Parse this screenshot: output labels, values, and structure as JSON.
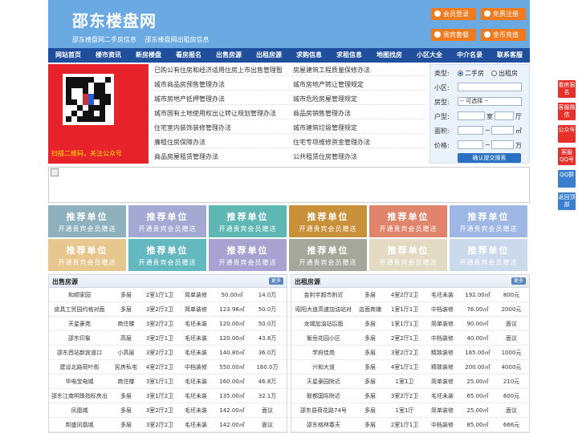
{
  "header": {
    "site_title": "邵东楼盘网",
    "sublinks": [
      "邵东楼盘网二手房信息",
      "邵东楼盘网出租房信息"
    ],
    "buttons": [
      "会员登录",
      "免费注册",
      "贵宾套餐",
      "金币充值"
    ]
  },
  "nav": [
    "网站首页",
    "楼市资讯",
    "新房楼盘",
    "看房报名",
    "出售房源",
    "出租房源",
    "求购信息",
    "求租信息",
    "地图找房",
    "小区大全",
    "中介名录",
    "联系客服"
  ],
  "qr": {
    "caption": "扫描二维码，关注公众号"
  },
  "links": [
    "已购公有住房和经济适用住房上市出售管理暂",
    "房屋建筑工程质量保修办法",
    "城市商品房预售管理办法",
    "城市房地产转让管理规定",
    "城市房地产抵押管理办法",
    "城市危险房屋管理规定",
    "城市国有土地使用权出让转让规划管理办法",
    "商品房销售管理办法",
    "住宅室内装饰装修管理办法",
    "城市建筑垃圾管理规定",
    "廉租住房保障办法",
    "住宅专项维修资金管理办法",
    "商品房屋租赁管理办法",
    "公共租赁住房管理办法"
  ],
  "search": {
    "type_label": "类型:",
    "type_options": [
      "二手房",
      "出租房"
    ],
    "area_label": "小区:",
    "room_label": "房型:",
    "room_value": "-- 可选择 --",
    "unit_label": "户型:",
    "unit_room": "室",
    "unit_hall": "厅",
    "size_label": "面积:",
    "size_unit": "㎡",
    "price_label": "价格:",
    "price_unit": "万",
    "submit": "确认提交搜索"
  },
  "ads": {
    "title": "推荐单位",
    "subtitle": "开通贵宾会员赠送",
    "colors": [
      "#8fb1bd",
      "#a3a9d2",
      "#5fb7b3",
      "#c9903a",
      "#e0846c",
      "#9fb7e4",
      "#e7c78e",
      "#64b8c0",
      "#a7a2cf",
      "#a5a79b",
      "#e3dac4",
      "#cbd9ec"
    ]
  },
  "sale": {
    "title": "出售房源",
    "more": "更多",
    "rows": [
      [
        "和顺家园",
        "多层",
        "2室1厅1卫",
        "简单装修",
        "50.00㎡",
        "14.0万"
      ],
      [
        "皮具工贸园约格对面",
        "多层",
        "3室2厅2卫",
        "简单装修",
        "123.98㎡",
        "50.0万"
      ],
      [
        "天星豪苑",
        "商住楼",
        "3室2厅2卫",
        "毛坯未装",
        "120.00㎡",
        "50.0万"
      ],
      [
        "邵东印象",
        "高层",
        "3室2厅1卫",
        "毛坯未装",
        "120.00㎡",
        "43.8万"
      ],
      [
        "邵东西站新宾道口",
        "小高层",
        "3室2厅2卫",
        "毛坯未装",
        "140.80㎡",
        "36.0万"
      ],
      [
        "建设北路荷叶街",
        "民房私宅",
        "4室2厅2卫",
        "中档装修",
        "550.00㎡",
        "160.0万"
      ],
      [
        "华电宝电城",
        "商住楼",
        "3室1厅1卫",
        "毛坯未装",
        "160.00㎡",
        "46.8万"
      ],
      [
        "邵东江南明珠指标房出",
        "多层",
        "3室1厅2卫",
        "毛坯未装",
        "135.00㎡",
        "32.1万"
      ],
      [
        "凤凰城",
        "多层",
        "3室2厅2卫",
        "毛坯未装",
        "142.00㎡",
        "面议"
      ],
      [
        "邦盛凤凰城",
        "多层",
        "3室2厅2卫",
        "毛坯未装",
        "142.00㎡",
        "面议"
      ]
    ]
  },
  "rent": {
    "title": "出租房源",
    "more": "更多",
    "rows": [
      [
        "金利宇超市附近",
        "多层",
        "4室2厅2卫",
        "毛坯未装",
        "192.00㎡",
        "800元"
      ],
      [
        "昭阳大道高速加油站对",
        "店面商铺",
        "1室1厅1卫",
        "中档装修",
        "76.00㎡",
        "2000元"
      ],
      [
        "龙城加油站后面",
        "多层",
        "1室1厅1卫",
        "简单装修",
        "90.00㎡",
        "面议"
      ],
      [
        "衡岳花园小区",
        "多层",
        "2室2厅1卫",
        "中档装修",
        "40.00㎡",
        "面议"
      ],
      [
        "学府佳苑",
        "多层",
        "3室2厅2卫",
        "精致装修",
        "165.00㎡",
        "1000元"
      ],
      [
        "兴和大道",
        "多层",
        "4室1厅1卫",
        "精致装修",
        "200.00㎡",
        "4000元"
      ],
      [
        "天星豪园附近",
        "多层",
        "1室1卫",
        "简单装修",
        "25.00㎡",
        "210元"
      ],
      [
        "联都国际附近",
        "多层",
        "3室2厅2卫",
        "毛坯未装",
        "65.00㎡",
        "600元"
      ],
      [
        "邵东县荷花路74号",
        "多层",
        "1室1厅",
        "简单装修",
        "25.00㎡",
        "面议"
      ],
      [
        "邵东格林春天",
        "多层",
        "2室1厅1卫",
        "中档装修",
        "85.00㎡",
        "666元"
      ]
    ]
  },
  "side": [
    "看房报名",
    "客服微信",
    "公众号",
    "客服QQ号",
    "QQ群",
    "返回顶部"
  ]
}
